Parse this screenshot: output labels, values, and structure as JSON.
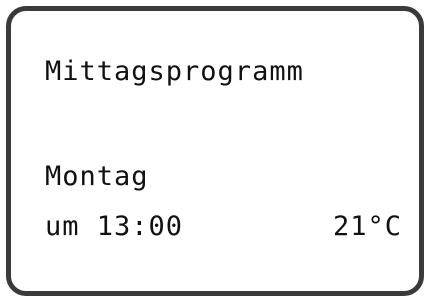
{
  "display": {
    "program_name": "Mittagsprogramm",
    "day": "Montag",
    "time": "um 13:00",
    "temperature": "21°C"
  }
}
